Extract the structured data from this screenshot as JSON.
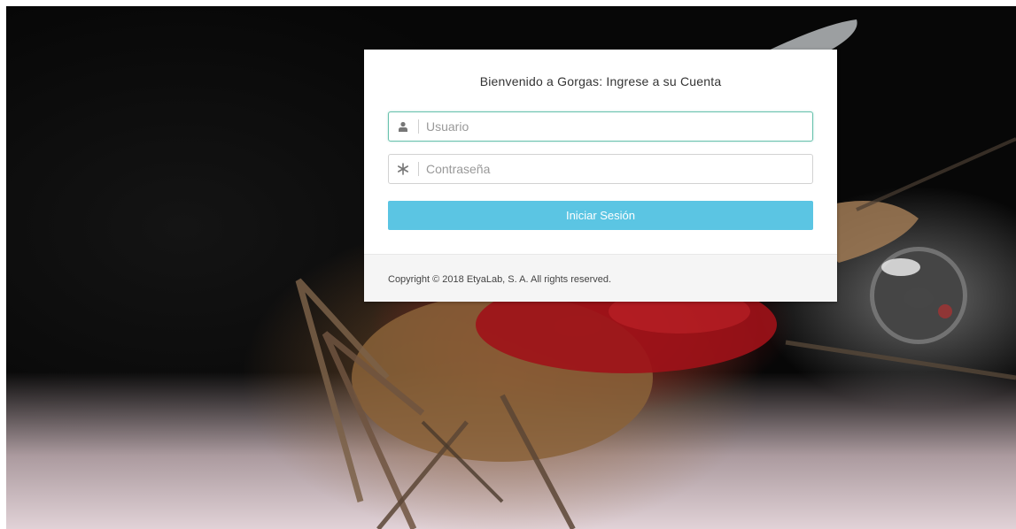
{
  "login_card": {
    "title": "Bienvenido a Gorgas: Ingrese a su Cuenta",
    "username": {
      "placeholder": "Usuario",
      "icon": "user-icon",
      "value": ""
    },
    "password": {
      "placeholder": "Contraseña",
      "icon": "asterisk-icon",
      "value": ""
    },
    "submit_label": "Iniciar Sesión",
    "footer": {
      "copyright": "Copyright © 2018 EtyaLab, S. A. All rights reserved."
    }
  },
  "colors": {
    "button": "#5bc5e3",
    "focus_border": "#69c2ad",
    "footer_bg": "#f5f5f5"
  }
}
